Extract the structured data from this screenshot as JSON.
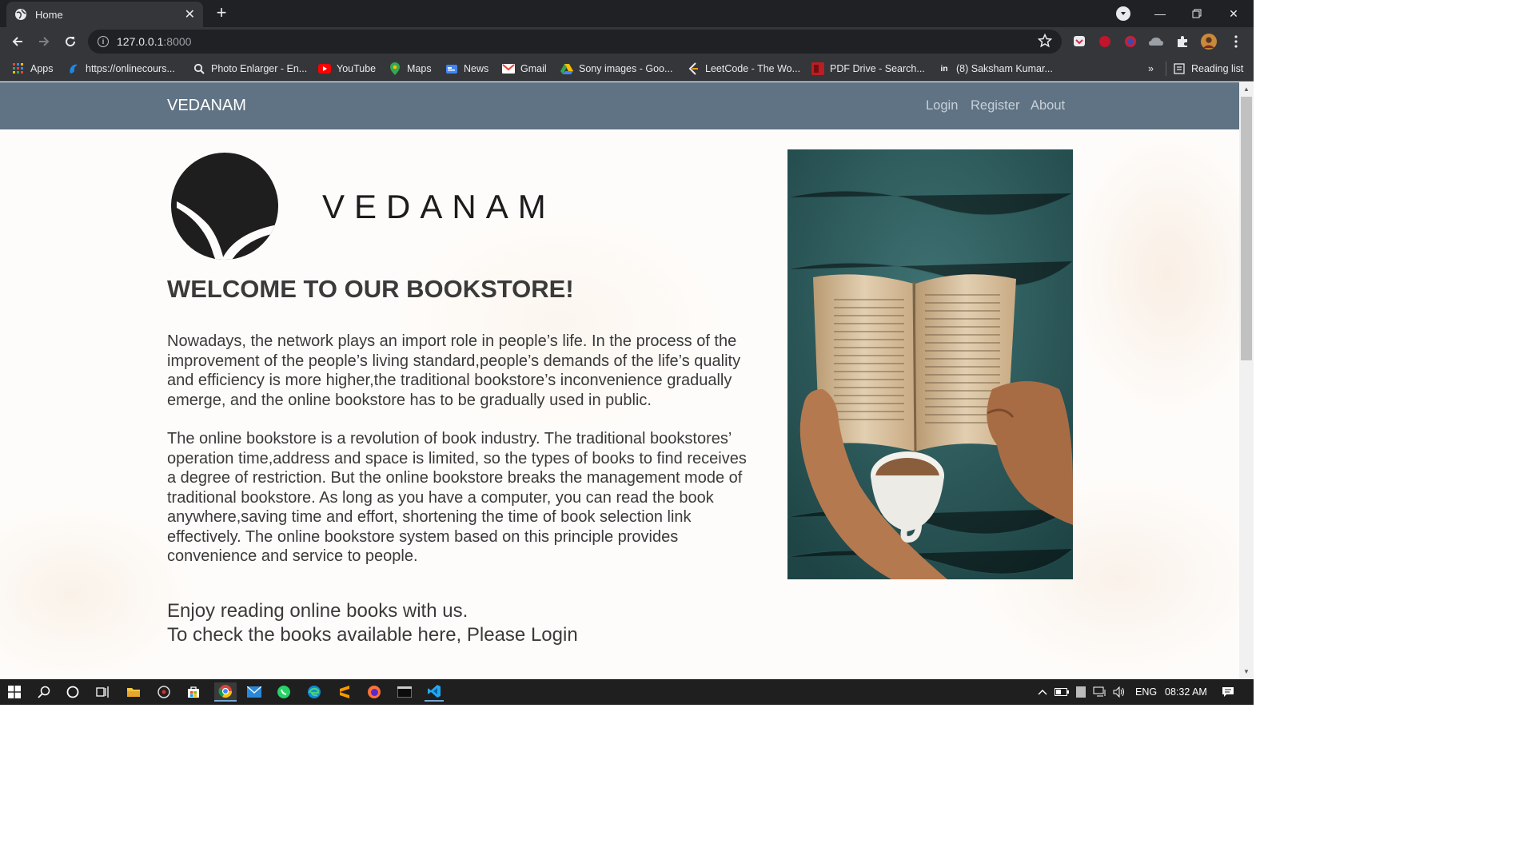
{
  "browser": {
    "tab_title": "Home",
    "url_host": "127.0.0.1",
    "url_port": ":8000",
    "bookmarks": [
      {
        "label": "Apps",
        "icon": "apps-grid-icon"
      },
      {
        "label": "https://onlinecours...",
        "icon": "globe-icon"
      },
      {
        "label": "Photo Enlarger - En...",
        "icon": "magnifier-icon"
      },
      {
        "label": "YouTube",
        "icon": "youtube-icon"
      },
      {
        "label": "Maps",
        "icon": "maps-icon"
      },
      {
        "label": "News",
        "icon": "news-icon"
      },
      {
        "label": "Gmail",
        "icon": "gmail-icon"
      },
      {
        "label": "Sony images - Goo...",
        "icon": "drive-icon"
      },
      {
        "label": "LeetCode - The Wo...",
        "icon": "leetcode-icon"
      },
      {
        "label": "PDF Drive - Search...",
        "icon": "pdf-drive-icon"
      },
      {
        "label": "(8) Saksham Kumar...",
        "icon": "linkedin-icon"
      }
    ],
    "overflow_label": "»",
    "reading_list": "Reading list"
  },
  "site": {
    "brand": "VEDANAM",
    "nav": {
      "login": "Login",
      "register": "Register",
      "about": "About"
    },
    "logo_text": "VEDANAM",
    "heading": "WELCOME TO OUR BOOKSTORE!",
    "para1": "Nowadays, the network plays an import role in people’s life. In the process of the improvement of the people’s living standard,people’s demands of the life’s quality and efficiency is more higher,the traditional bookstore’s inconvenience gradually emerge, and the online bookstore has to be gradually used in public.",
    "para2": "The online bookstore is a revolution of book industry. The traditional bookstores’ operation time,address and space is limited, so the types of books to find receives a degree of restriction. But the online bookstore breaks the management mode of traditional bookstore. As long as you have a computer, you can read the book anywhere,saving time and effort, shortening the time of book selection link effectively. The online bookstore system based on this principle provides convenience and service to people.",
    "cta_line1": "Enjoy reading online books with us.",
    "cta_line2": "To check the books available here, Please Login"
  },
  "taskbar": {
    "lang": "ENG",
    "time": "08:32 AM"
  },
  "colors": {
    "navbar": "#5f7384",
    "chrome_dark": "#202124",
    "chrome_toolbar": "#35363a",
    "page_text": "#3a3a3a"
  }
}
